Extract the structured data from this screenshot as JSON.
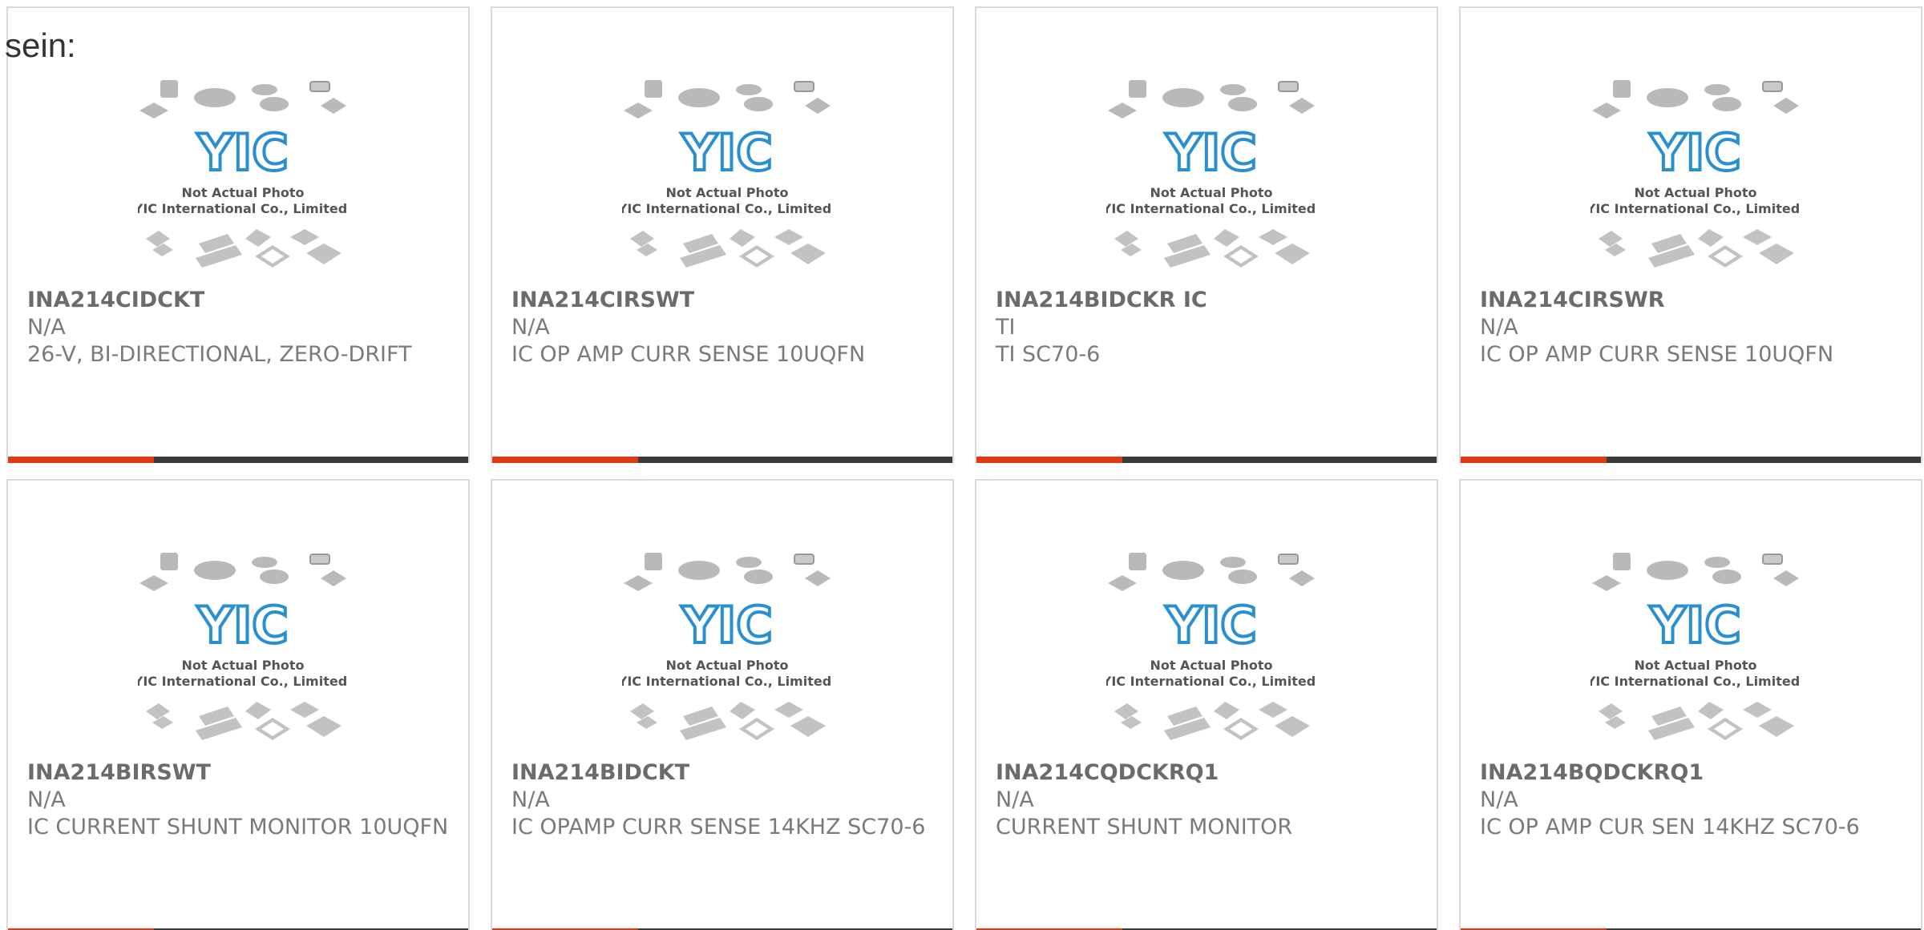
{
  "corner_label": "sein:",
  "brand_colors": {
    "accent": "#e03a12",
    "bar": "#3a3a3a",
    "logo": "#2a8fd0"
  },
  "photo": {
    "logo_text": "YIC",
    "line1": "Not Actual Photo",
    "line2": "YIC International Co., Limited."
  },
  "products": [
    {
      "part": "INA214CIDCKT",
      "maker": "N/A",
      "desc": "26-V, BI-DIRECTIONAL, ZERO-DRIFT"
    },
    {
      "part": "INA214CIRSWT",
      "maker": "N/A",
      "desc": "IC OP AMP CURR SENSE 10UQFN"
    },
    {
      "part": "INA214BIDCKR IC",
      "maker": "TI",
      "desc": "TI SC70-6"
    },
    {
      "part": "INA214CIRSWR",
      "maker": "N/A",
      "desc": "IC OP AMP CURR SENSE 10UQFN"
    },
    {
      "part": "INA214BIRSWT",
      "maker": "N/A",
      "desc": "IC CURRENT SHUNT MONITOR 10UQFN"
    },
    {
      "part": "INA214BIDCKT",
      "maker": "N/A",
      "desc": "IC OPAMP CURR SENSE 14KHZ SC70-6"
    },
    {
      "part": "INA214CQDCKRQ1",
      "maker": "N/A",
      "desc": "CURRENT SHUNT MONITOR"
    },
    {
      "part": "INA214BQDCKRQ1",
      "maker": "N/A",
      "desc": "IC OP AMP CUR SEN 14KHZ SC70-6"
    }
  ]
}
